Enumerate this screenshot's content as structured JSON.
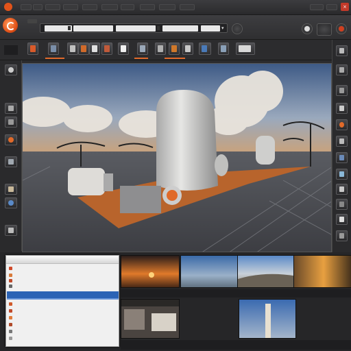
{
  "window": {
    "title_menus": [
      "",
      "",
      "",
      "",
      "",
      "",
      "",
      "",
      "",
      "",
      "",
      ""
    ],
    "win_controls": {
      "close": "×"
    }
  },
  "app": {
    "brand_label": "",
    "logo_icon": "app-logo-icon"
  },
  "address_bar": {
    "segments": [
      "",
      "",
      "",
      "",
      ""
    ]
  },
  "toolbar": {
    "tools": [
      "pointer-tool-icon",
      "camera-tool-icon",
      "image-tool-icon",
      "paint-tool-icon",
      "text-tool-icon",
      "frame-tool-icon",
      "crop-tool-icon",
      "layer-tool-icon",
      "brush-tool-icon",
      "render-tool-icon",
      "scene-tool-icon",
      "view-tool-icon"
    ]
  },
  "left_panel": {
    "header": ""
  },
  "dialog": {
    "title": "",
    "rows": [
      "",
      "",
      "",
      "",
      "",
      "",
      "",
      "",
      "",
      "",
      ""
    ],
    "selected_row": ""
  },
  "thumbnails": {
    "captions": [
      "",
      "",
      "",
      "",
      "",
      "",
      "",
      ""
    ]
  },
  "colors": {
    "accent": "#e1692a",
    "selection": "#2b63b5",
    "panel_bg": "#2a2a2c"
  }
}
